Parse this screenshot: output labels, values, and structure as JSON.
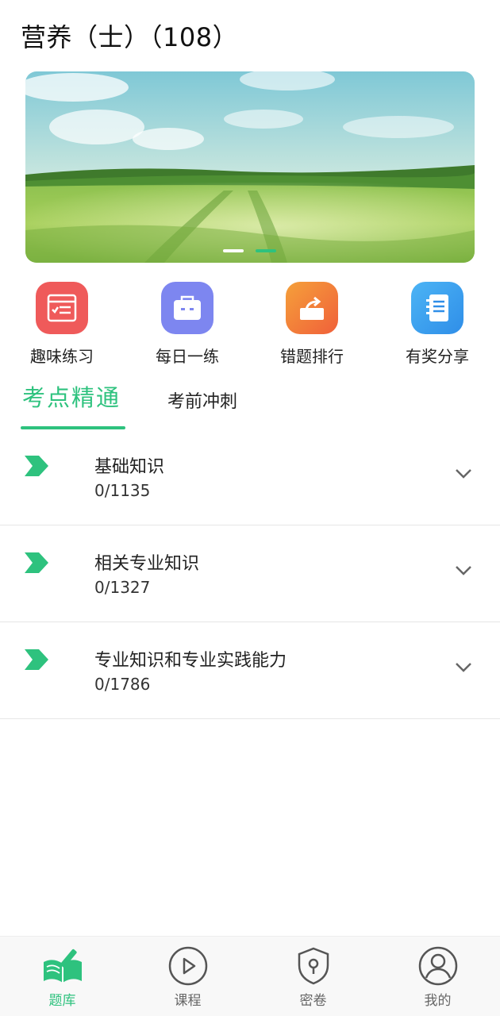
{
  "header": {
    "title": "营养（士）（108）"
  },
  "banner": {
    "slides": 2,
    "active_slide": 2
  },
  "quick_actions": [
    {
      "label": "趣味练习",
      "icon": "quiz-sheet-icon",
      "color": "#ef5a5a"
    },
    {
      "label": "每日一练",
      "icon": "briefcase-icon",
      "color": "#7d86f0"
    },
    {
      "label": "错题排行",
      "icon": "share-box-icon",
      "color": "#f57c3a"
    },
    {
      "label": "有奖分享",
      "icon": "notebook-icon",
      "color": "#3aa0f0"
    }
  ],
  "tabs": {
    "active": "考点精通",
    "inactive": "考前冲刺"
  },
  "sections": [
    {
      "title": "基础知识",
      "progress": "0/1135"
    },
    {
      "title": "相关专业知识",
      "progress": "0/1327"
    },
    {
      "title": "专业知识和专业实践能力",
      "progress": "0/1786"
    }
  ],
  "nav": [
    {
      "label": "题库",
      "icon": "book-pen-icon",
      "active": true
    },
    {
      "label": "课程",
      "icon": "play-circle-icon",
      "active": false
    },
    {
      "label": "密卷",
      "icon": "shield-lock-icon",
      "active": false
    },
    {
      "label": "我的",
      "icon": "user-circle-icon",
      "active": false
    }
  ],
  "colors": {
    "accent": "#2ec27e",
    "text": "#222222",
    "divider": "#e6e6e6"
  }
}
